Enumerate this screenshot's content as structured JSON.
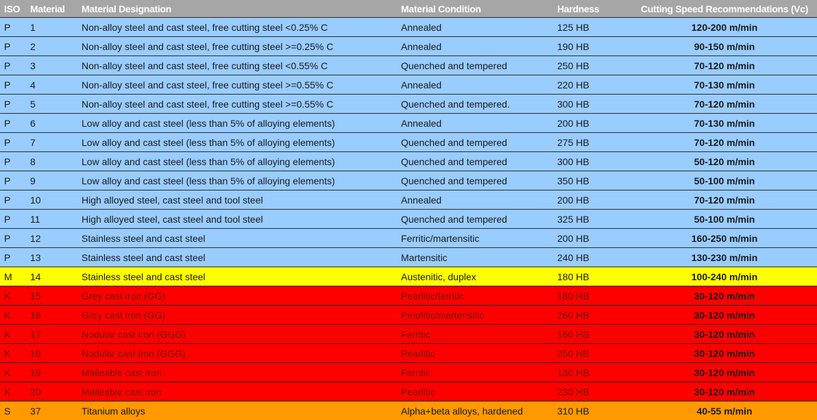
{
  "table": {
    "headers": {
      "iso": "ISO",
      "material": "Material",
      "designation": "Material Designation",
      "condition": "Material Condition",
      "hardness": "Hardness",
      "speed": "Cutting Speed Recommendations (Vc)"
    },
    "group_colors": {
      "P": "#99ccff",
      "M": "#ffff00",
      "K": "#ff0000",
      "S": "#ff9900",
      "header": "#a6a6a6"
    },
    "rows": [
      {
        "iso": "P",
        "material": "1",
        "designation": "Non-alloy steel and cast steel, free cutting steel <0.25% C",
        "condition": "Annealed",
        "hardness": "125 HB",
        "speed": "120-200 m/min"
      },
      {
        "iso": "P",
        "material": "2",
        "designation": "Non-alloy steel and cast steel, free cutting steel >=0.25% C",
        "condition": "Annealed",
        "hardness": "190 HB",
        "speed": "90-150 m/min"
      },
      {
        "iso": "P",
        "material": "3",
        "designation": "Non-alloy steel and cast steel, free cutting steel <0.55% C",
        "condition": "Quenched and tempered",
        "hardness": "250 HB",
        "speed": "70-120 m/min"
      },
      {
        "iso": "P",
        "material": "4",
        "designation": "Non-alloy steel and cast steel, free cutting steel >=0.55% C",
        "condition": "Annealed",
        "hardness": "220 HB",
        "speed": "70-130 m/min"
      },
      {
        "iso": "P",
        "material": "5",
        "designation": "Non-alloy steel and cast steel, free cutting steel >=0.55% C",
        "condition": "Quenched and tempered.",
        "hardness": "300 HB",
        "speed": "70-120 m/min"
      },
      {
        "iso": "P",
        "material": "6",
        "designation": "Low alloy and cast steel (less than 5% of alloying elements)",
        "condition": "Annealed",
        "hardness": "200 HB",
        "speed": "70-130 m/min"
      },
      {
        "iso": "P",
        "material": "7",
        "designation": "Low alloy and cast steel (less than 5% of alloying elements)",
        "condition": "Quenched and tempered",
        "hardness": "275 HB",
        "speed": "70-120 m/min"
      },
      {
        "iso": "P",
        "material": "8",
        "designation": "Low alloy and cast steel (less than 5% of alloying elements)",
        "condition": "Quenched and tempered",
        "hardness": "300 HB",
        "speed": "50-120 m/min"
      },
      {
        "iso": "P",
        "material": "9",
        "designation": "Low alloy and cast steel (less than 5% of alloying elements)",
        "condition": "Quenched and tempered",
        "hardness": "350 HB",
        "speed": "50-100 m/min"
      },
      {
        "iso": "P",
        "material": "10",
        "designation": "High alloyed steel, cast steel and tool steel",
        "condition": "Annealed",
        "hardness": "200 HB",
        "speed": "70-120 m/min"
      },
      {
        "iso": "P",
        "material": "11",
        "designation": "High alloyed steel, cast steel and tool steel",
        "condition": "Quenched and tempered",
        "hardness": "325 HB",
        "speed": "50-100 m/min"
      },
      {
        "iso": "P",
        "material": "12",
        "designation": "Stainless steel and cast steel",
        "condition": "Ferritic/martensitic",
        "hardness": "200 HB",
        "speed": "160-250 m/min"
      },
      {
        "iso": "P",
        "material": "13",
        "designation": "Stainless steel and cast steel",
        "condition": "Martensitic",
        "hardness": "240 HB",
        "speed": "130-230 m/min"
      },
      {
        "iso": "M",
        "material": "14",
        "designation": "Stainless steel and cast steel",
        "condition": "Austenitic, duplex",
        "hardness": "180 HB",
        "speed": "100-240 m/min"
      },
      {
        "iso": "K",
        "material": "15",
        "designation": "Grey cast iron (GG)",
        "condition": "Pearlitic/ferritic",
        "hardness": "180 HB",
        "speed": "30-120 m/min"
      },
      {
        "iso": "K",
        "material": "16",
        "designation": "Grey cast iron (GG)",
        "condition": "Pearlitic/martensitic",
        "hardness": "260 HB",
        "speed": "30-120 m/min"
      },
      {
        "iso": "K",
        "material": "17",
        "designation": "Nodular cast iron (GGG)",
        "condition": "Ferritic",
        "hardness": "160 HB",
        "speed": "30-120 m/min"
      },
      {
        "iso": "K",
        "material": "18",
        "designation": "Nodular cast iron (GGG)",
        "condition": "Pearlitic",
        "hardness": "250 HB",
        "speed": "30-120 m/min"
      },
      {
        "iso": "K",
        "material": "19",
        "designation": "Malleable cast iron",
        "condition": "Ferritic",
        "hardness": "130 HB",
        "speed": "30-120 m/min"
      },
      {
        "iso": "K",
        "material": "20",
        "designation": "Malleable cast iron",
        "condition": "Pearlitic",
        "hardness": "230 HB",
        "speed": "30-120 m/min"
      },
      {
        "iso": "S",
        "material": "37",
        "designation": "Titanium alloys",
        "condition": "Alpha+beta alloys, hardened",
        "hardness": "310 HB",
        "speed": "40-55 m/min"
      }
    ]
  }
}
